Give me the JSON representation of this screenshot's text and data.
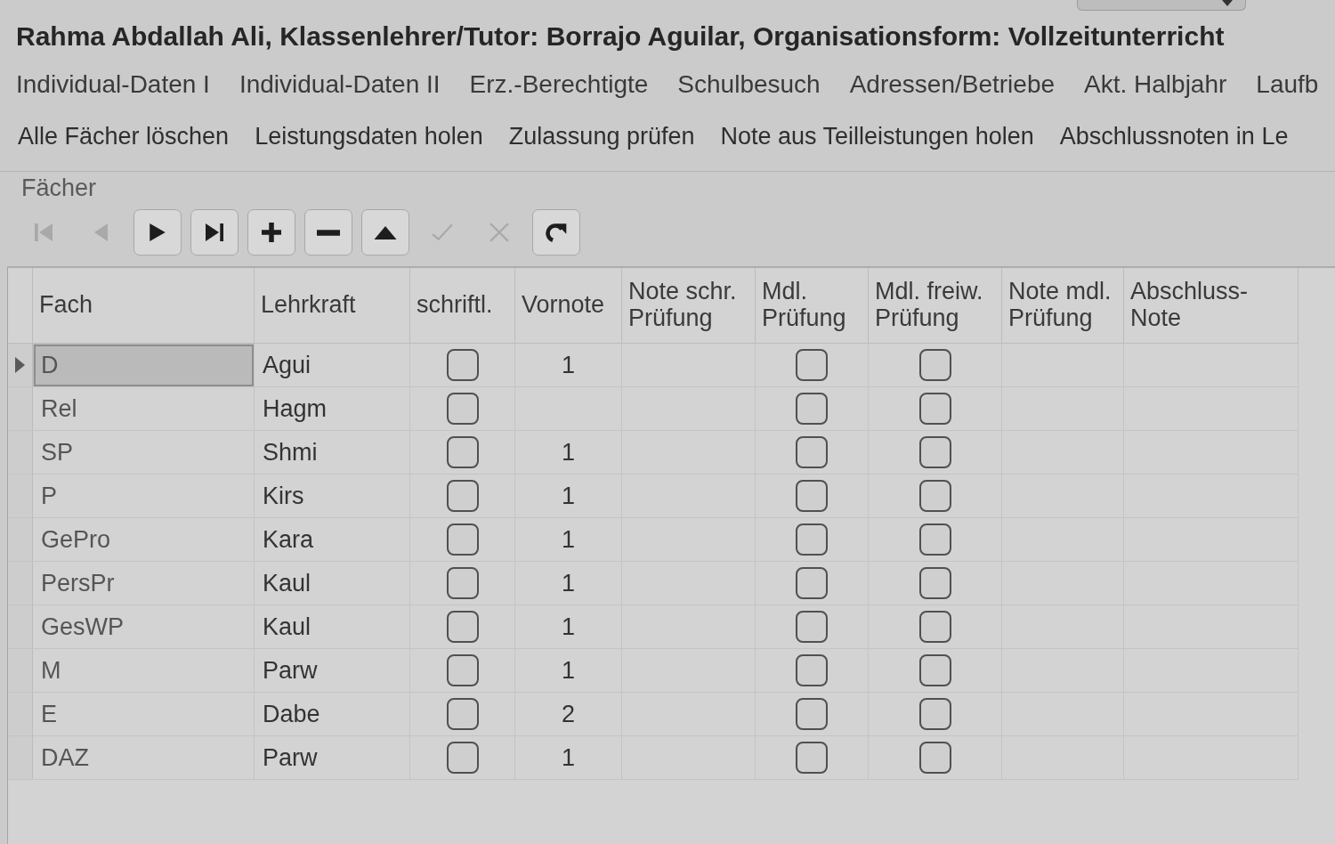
{
  "header": {
    "title": "Rahma Abdallah Ali, Klassenlehrer/Tutor: Borrajo Aguilar, Organisationsform: Vollzeitunterricht"
  },
  "tabs": [
    "Individual-Daten I",
    "Individual-Daten II",
    "Erz.-Berechtigte",
    "Schulbesuch",
    "Adressen/Betriebe",
    "Akt. Halbjahr",
    "Laufb"
  ],
  "actions": [
    "Alle Fächer löschen",
    "Leistungsdaten holen",
    "Zulassung prüfen",
    "Note aus Teilleistungen holen",
    "Abschlussnoten in Le"
  ],
  "subjects": {
    "title": "Fächer",
    "toolbar": [
      {
        "kind": "first",
        "disabled": true
      },
      {
        "kind": "prior",
        "disabled": true
      },
      {
        "kind": "next",
        "disabled": false
      },
      {
        "kind": "last",
        "disabled": false
      },
      {
        "kind": "insert",
        "disabled": false
      },
      {
        "kind": "delete",
        "disabled": false
      },
      {
        "kind": "edit",
        "disabled": false
      },
      {
        "kind": "post",
        "disabled": true
      },
      {
        "kind": "cancel",
        "disabled": true
      },
      {
        "kind": "refresh",
        "disabled": false
      }
    ],
    "columns": [
      {
        "label": "Fach",
        "kind": "text"
      },
      {
        "label": "Lehrkraft",
        "kind": "text"
      },
      {
        "label": "schriftl.",
        "kind": "check"
      },
      {
        "label": "Vornote",
        "kind": "number"
      },
      {
        "label": "Note schr. Prüfung",
        "kind": "number"
      },
      {
        "label": "Mdl. Prüfung",
        "kind": "check"
      },
      {
        "label": "Mdl. freiw. Prüfung",
        "kind": "check"
      },
      {
        "label": "Note mdl. Prüfung",
        "kind": "number"
      },
      {
        "label": "Abschluss-Note",
        "kind": "number"
      }
    ],
    "rows": [
      {
        "selected": true,
        "fach": "D",
        "lehrkraft": "Agui",
        "schriftl": false,
        "vornote": "1",
        "mdl_pruefung": false,
        "mdl_freiw_pruefung": false
      },
      {
        "selected": false,
        "fach": "Rel",
        "lehrkraft": "Hagm",
        "schriftl": false,
        "mdl_pruefung": false,
        "mdl_freiw_pruefung": false
      },
      {
        "selected": false,
        "fach": "SP",
        "lehrkraft": "Shmi",
        "schriftl": false,
        "vornote": "1",
        "mdl_pruefung": false,
        "mdl_freiw_pruefung": false
      },
      {
        "selected": false,
        "fach": "P",
        "lehrkraft": "Kirs",
        "schriftl": false,
        "vornote": "1",
        "mdl_pruefung": false,
        "mdl_freiw_pruefung": false
      },
      {
        "selected": false,
        "fach": "GePro",
        "lehrkraft": "Kara",
        "schriftl": false,
        "vornote": "1",
        "mdl_pruefung": false,
        "mdl_freiw_pruefung": false
      },
      {
        "selected": false,
        "fach": "PersPr",
        "lehrkraft": "Kaul",
        "schriftl": false,
        "vornote": "1",
        "mdl_pruefung": false,
        "mdl_freiw_pruefung": false
      },
      {
        "selected": false,
        "fach": "GesWP",
        "lehrkraft": "Kaul",
        "schriftl": false,
        "vornote": "1",
        "mdl_pruefung": false,
        "mdl_freiw_pruefung": false
      },
      {
        "selected": false,
        "fach": "M",
        "lehrkraft": "Parw",
        "schriftl": false,
        "vornote": "1",
        "mdl_pruefung": false,
        "mdl_freiw_pruefung": false
      },
      {
        "selected": false,
        "fach": "E",
        "lehrkraft": "Dabe",
        "schriftl": false,
        "vornote": "2",
        "mdl_pruefung": false,
        "mdl_freiw_pruefung": false
      },
      {
        "selected": false,
        "fach": "DAZ",
        "lehrkraft": "Parw",
        "schriftl": false,
        "vornote": "1",
        "mdl_pruefung": false,
        "mdl_freiw_pruefung": false
      }
    ]
  }
}
